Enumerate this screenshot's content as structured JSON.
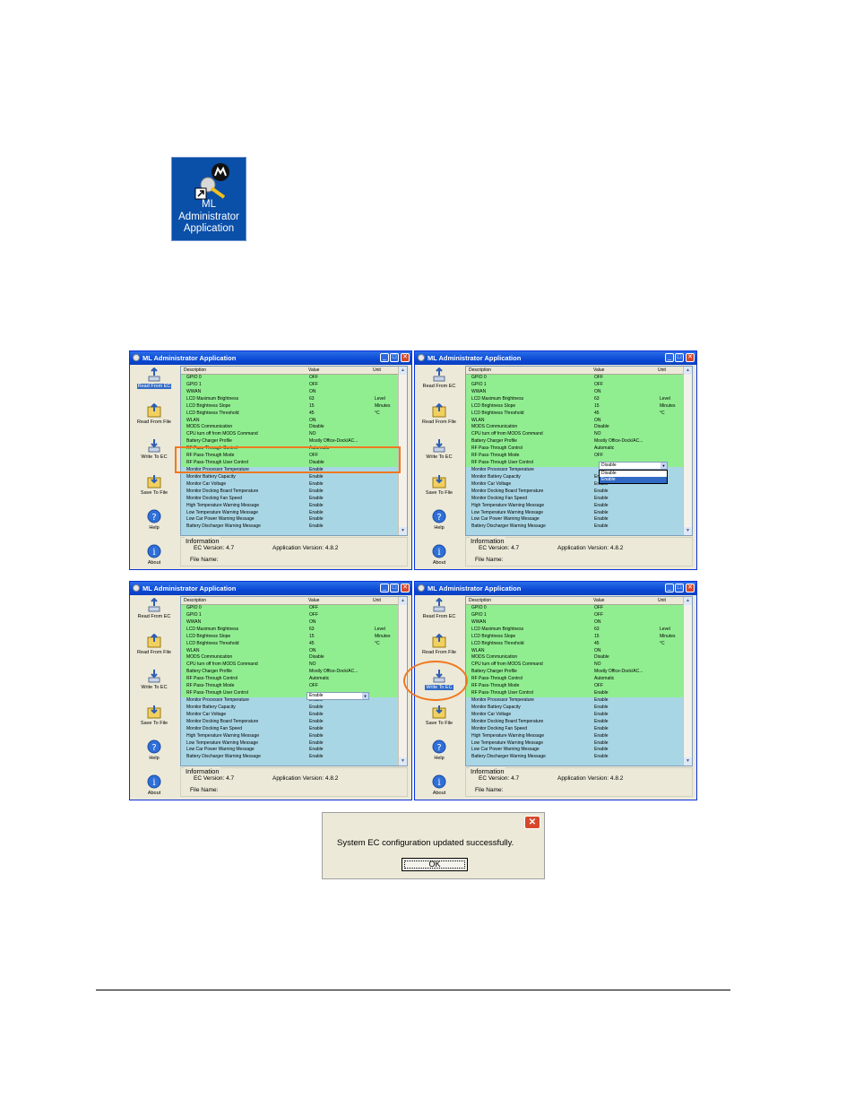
{
  "desktop_icon": {
    "label_lines": [
      "ML",
      "Administrator",
      "Application"
    ]
  },
  "window": {
    "title": "ML Administrator Application",
    "sidebar": [
      "Read From EC",
      "Read From File",
      "Write To EC",
      "Save To File",
      "Help",
      "About"
    ],
    "columns": [
      "Description",
      "Value",
      "Unit"
    ],
    "info": {
      "legend": "Information",
      "ec_version_label": "EC Version:",
      "ec_version": "4.7",
      "app_version_label": "Application Version:",
      "app_version": "4.8.2",
      "file_name_label": "File Name:"
    },
    "rows": [
      {
        "desc": "GPIO 0",
        "unit": ""
      },
      {
        "desc": "GPIO 1",
        "unit": ""
      },
      {
        "desc": "WWAN",
        "unit": ""
      },
      {
        "desc": "LCD Maximum Brightness",
        "unit": "Level"
      },
      {
        "desc": "LCD Brightness Slope",
        "unit": "Minutes"
      },
      {
        "desc": "LCD Brightness Threshold",
        "unit": "°C"
      },
      {
        "desc": "WLAN",
        "unit": ""
      },
      {
        "desc": "MODS Communication",
        "unit": ""
      },
      {
        "desc": "CPU turn off from MODS Command",
        "unit": ""
      },
      {
        "desc": "Battery Charger Profile",
        "unit": ""
      },
      {
        "desc": "RF Pass-Through Control",
        "unit": ""
      },
      {
        "desc": "RF Pass-Through Mode",
        "unit": ""
      },
      {
        "desc": "RF Pass-Through User Control",
        "unit": ""
      },
      {
        "desc": "Monitor Processor Temperature",
        "unit": ""
      },
      {
        "desc": "Monitor Battery Capacity",
        "unit": ""
      },
      {
        "desc": "Monitor Car Voltage",
        "unit": ""
      },
      {
        "desc": "Monitor Docking Board Temperature",
        "unit": ""
      },
      {
        "desc": "Monitor Docking Fan Speed",
        "unit": ""
      },
      {
        "desc": "High Temperature Warning Message",
        "unit": ""
      },
      {
        "desc": "Low Temperature Warning Message",
        "unit": ""
      },
      {
        "desc": "Low Car Power Warning Message",
        "unit": ""
      },
      {
        "desc": "Battery Discharger Warning Message",
        "unit": ""
      }
    ],
    "green_count": 13
  },
  "panels": [
    {
      "values": [
        "OFF",
        "OFF",
        "ON",
        "63",
        "15",
        "45",
        "ON",
        "Disable",
        "NO",
        "Mostly Office-Dock/AC...",
        "Automatic",
        "OFF",
        "Disable",
        "Enable",
        "Enable",
        "Enable",
        "Enable",
        "Enable",
        "Enable",
        "Enable",
        "Enable",
        "Enable"
      ]
    },
    {
      "values": [
        "OFF",
        "OFF",
        "ON",
        "63",
        "15",
        "45",
        "ON",
        "Disable",
        "NO",
        "Mostly Office-Dock/AC...",
        "Automatic",
        "OFF",
        "",
        "",
        "Enable",
        "Enable",
        "Enable",
        "Enable",
        "Enable",
        "Enable",
        "Enable",
        "Enable"
      ],
      "dropdown_value": "Disable",
      "dropdown_options": [
        "Disable",
        "Enable"
      ]
    },
    {
      "values": [
        "OFF",
        "OFF",
        "ON",
        "63",
        "15",
        "45",
        "ON",
        "Disable",
        "NO",
        "Mostly Office-Dock/AC...",
        "Automatic",
        "OFF",
        "",
        "Enable",
        "Enable",
        "Enable",
        "Enable",
        "Enable",
        "Enable",
        "Enable",
        "Enable",
        "Enable"
      ],
      "dropdown_value": "Enable"
    },
    {
      "values": [
        "OFF",
        "OFF",
        "ON",
        "63",
        "15",
        "45",
        "ON",
        "Disable",
        "NO",
        "Mostly Office-Dock/AC...",
        "Automatic",
        "OFF",
        "Enable",
        "Enable",
        "Enable",
        "Enable",
        "Enable",
        "Enable",
        "Enable",
        "Enable",
        "Enable",
        "Enable"
      ]
    }
  ],
  "dialog": {
    "message": "System EC configuration updated successfully.",
    "ok": "OK"
  },
  "colors": {
    "highlight": "#f07820",
    "row_green": "#90ee90",
    "row_blue": "#a9d6e5",
    "title_blue": "#0a4ad6"
  }
}
